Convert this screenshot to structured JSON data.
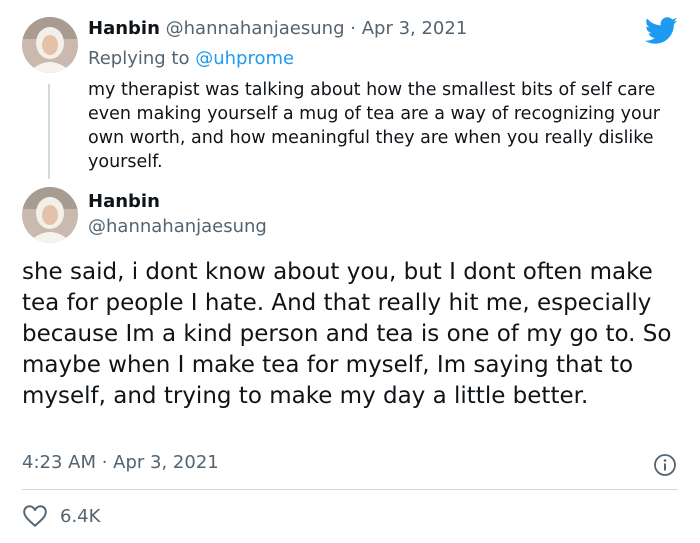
{
  "colors": {
    "accent": "#1d9bf0",
    "text": "#0f1419",
    "muted": "#536471",
    "divider": "#cfd9de"
  },
  "reply_tweet": {
    "author_name": "Hanbin",
    "author_handle": "@hannahanjaesung",
    "separator": "·",
    "date": "Apr 3, 2021",
    "replying_prefix": "Replying to",
    "replying_to": "@uhprome",
    "text": "my therapist was talking about how the smallest bits of self care even making yourself a mug of tea are a way of recognizing your own worth, and how meaningful they are when you really dislike yourself."
  },
  "main_tweet": {
    "author_name": "Hanbin",
    "author_handle": "@hannahanjaesung",
    "text": "she said, i dont know about you, but I dont often make tea for people I hate. And that really hit me, especially because Im a kind person and tea is one of my go to. So maybe when I make tea for myself, Im saying that to myself, and trying to make my day a little better.",
    "timestamp": "4:23 AM · Apr 3, 2021",
    "likes": "6.4K"
  },
  "icons": {
    "brand": "twitter-bird-icon",
    "info": "info-icon",
    "like": "heart-icon"
  }
}
